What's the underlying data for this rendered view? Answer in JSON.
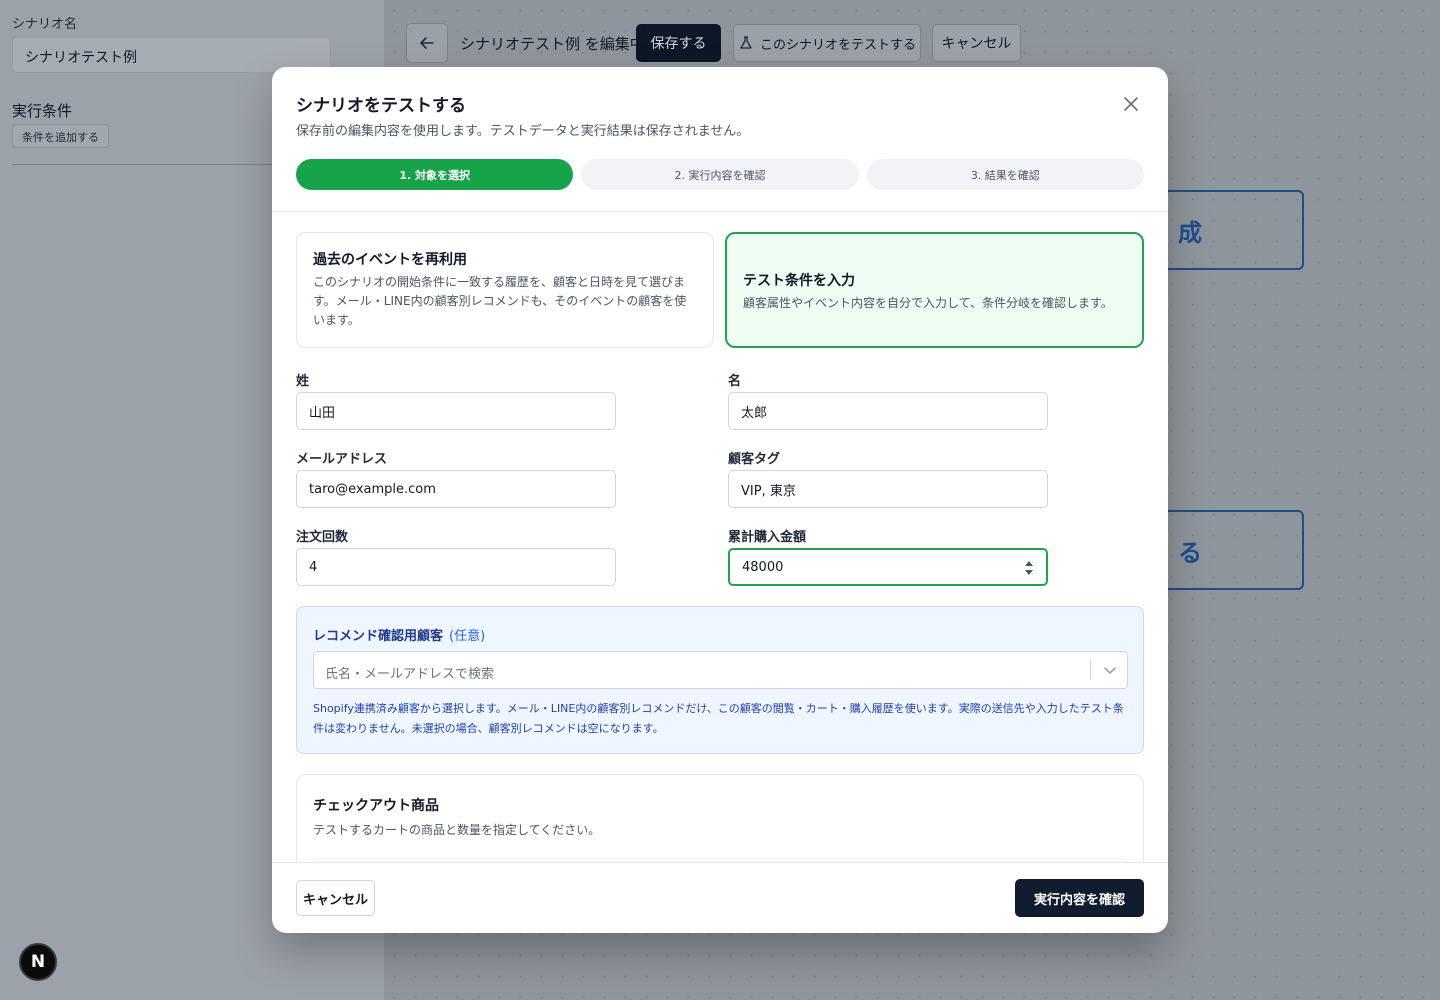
{
  "sidebar": {
    "scenario_name_label": "シナリオ名",
    "scenario_name_value": "シナリオテスト例",
    "conditions_heading": "実行条件",
    "add_condition_button": "条件を追加する"
  },
  "toolbar": {
    "editing_title": "シナリオテスト例 を編集中",
    "save_label": "保存する",
    "test_label": "このシナリオをテストする",
    "cancel_label": "キャンセル"
  },
  "canvas": {
    "node1_fragment": "成",
    "node2_fragment": "る"
  },
  "modal": {
    "title": "シナリオをテストする",
    "subtitle": "保存前の編集内容を使用します。テストデータと実行結果は保存されません。",
    "steps": [
      {
        "label": "1. 対象を選択",
        "active": true
      },
      {
        "label": "2. 実行内容を確認",
        "active": false
      },
      {
        "label": "3. 結果を確認",
        "active": false
      }
    ],
    "option_past": {
      "title": "過去のイベントを再利用",
      "desc": "このシナリオの開始条件に一致する履歴を、顧客と日時を見て選びます。メール・LINE内の顧客別レコメンドも、そのイベントの顧客を使います。"
    },
    "option_manual": {
      "title": "テスト条件を入力",
      "desc": "顧客属性やイベント内容を自分で入力して、条件分岐を確認します。"
    },
    "fields": {
      "last_name": {
        "label": "姓",
        "value": "山田"
      },
      "first_name": {
        "label": "名",
        "value": "太郎"
      },
      "email": {
        "label": "メールアドレス",
        "value": "taro@example.com"
      },
      "tags": {
        "label": "顧客タグ",
        "value": "VIP, 東京"
      },
      "order_count": {
        "label": "注文回数",
        "value": "4"
      },
      "total_spent": {
        "label": "累計購入金額",
        "value": "48000"
      }
    },
    "recommend": {
      "title": "レコメンド確認用顧客",
      "optional": "(任意)",
      "placeholder": "氏名・メールアドレスで検索",
      "help": "Shopify連携済み顧客から選択します。メール・LINE内の顧客別レコメンドだけ、この顧客の閲覧・カート・購入履歴を使います。実際の送信先や入力したテスト条件は変わりません。未選択の場合、顧客別レコメンドは空になります。"
    },
    "checkout": {
      "title": "チェックアウト商品",
      "subtitle": "テストするカートの商品と数量を指定してください。"
    },
    "footer": {
      "cancel_label": "キャンセル",
      "next_label": "実行内容を確認"
    }
  },
  "colors": {
    "accent_green": "#16a34a",
    "dark_button": "#111c2e",
    "info_blue": "#1e40af"
  }
}
